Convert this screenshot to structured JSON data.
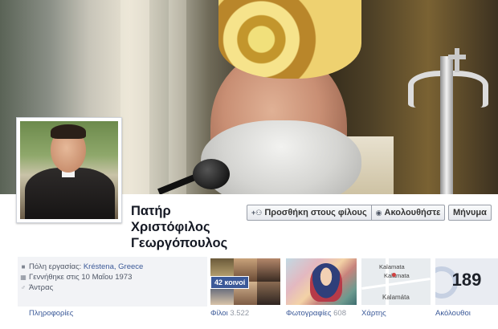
{
  "profile": {
    "name": "Πατήρ Χριστόφιλος Γεωργόπουλος"
  },
  "actions": {
    "add_friend": "Προσθήκη στους φίλους",
    "follow": "Ακολουθήστε",
    "message": "Μήνυμα"
  },
  "info": {
    "work_prefix": "Πόλη εργασίας:",
    "work_value": "Kréstena, Greece",
    "born": "Γεννήθηκε στις 10 Μαΐου 1973",
    "gender": "Άντρας",
    "link_label": "Πληροφορίες"
  },
  "apps": {
    "friends_label": "Φίλοι",
    "friends_count": "3.522",
    "mutual_badge": "42 κοινοί",
    "photos_label": "Φωτογραφίες",
    "photos_count": "608",
    "map_label": "Χάρτης",
    "map_place_1": "Kalamata",
    "map_place_2": "Kalamata",
    "map_place_3": "Kalamáta",
    "followers_label": "Ακόλουθοι",
    "followers_count": "189"
  },
  "icons": {
    "work": "briefcase-icon",
    "birthday": "calendar-icon",
    "gender": "male-icon",
    "add_friend": "add-friend-icon",
    "follow": "rss-icon"
  },
  "colors": {
    "link": "#3b5998",
    "button_bg": "#f0f1f4",
    "info_bg": "#f2f3f6"
  }
}
